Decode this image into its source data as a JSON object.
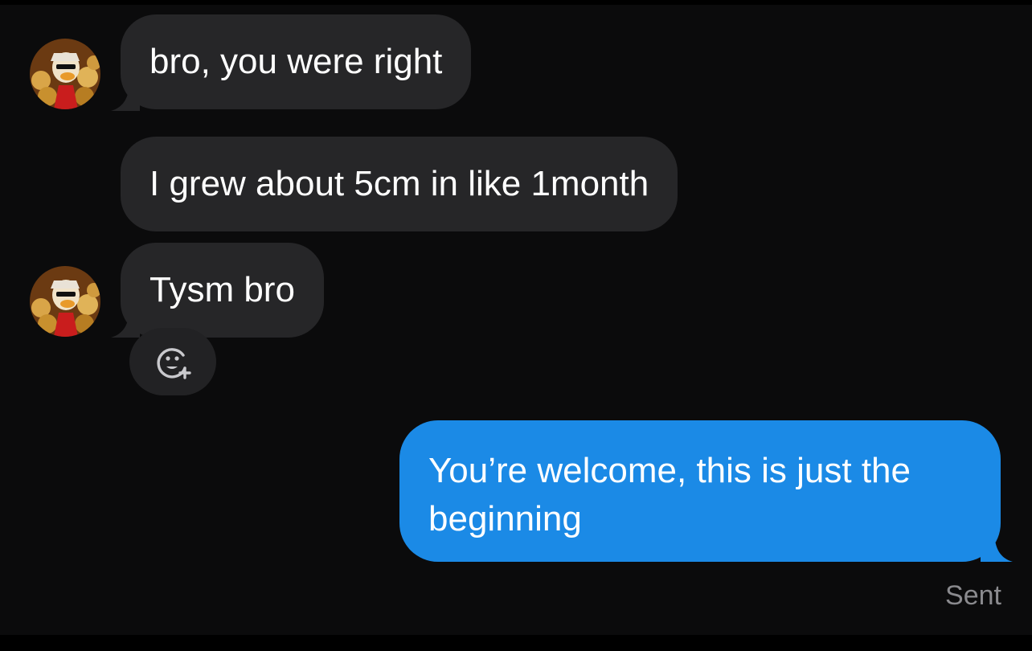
{
  "conversation": {
    "messages": [
      {
        "sender": "contact",
        "text": "bro, you were right"
      },
      {
        "sender": "contact",
        "text": "I grew about 5cm in like 1month"
      },
      {
        "sender": "contact",
        "text": "Tysm bro"
      },
      {
        "sender": "me",
        "text": "You’re welcome, this is just the beginning"
      }
    ],
    "status": "Sent",
    "reaction_icon": "add-reaction-icon"
  },
  "colors": {
    "background": "#0b0b0c",
    "incoming_bubble": "#262628",
    "outgoing_bubble": "#1b8ae6",
    "status_text": "#8a8a8e"
  }
}
